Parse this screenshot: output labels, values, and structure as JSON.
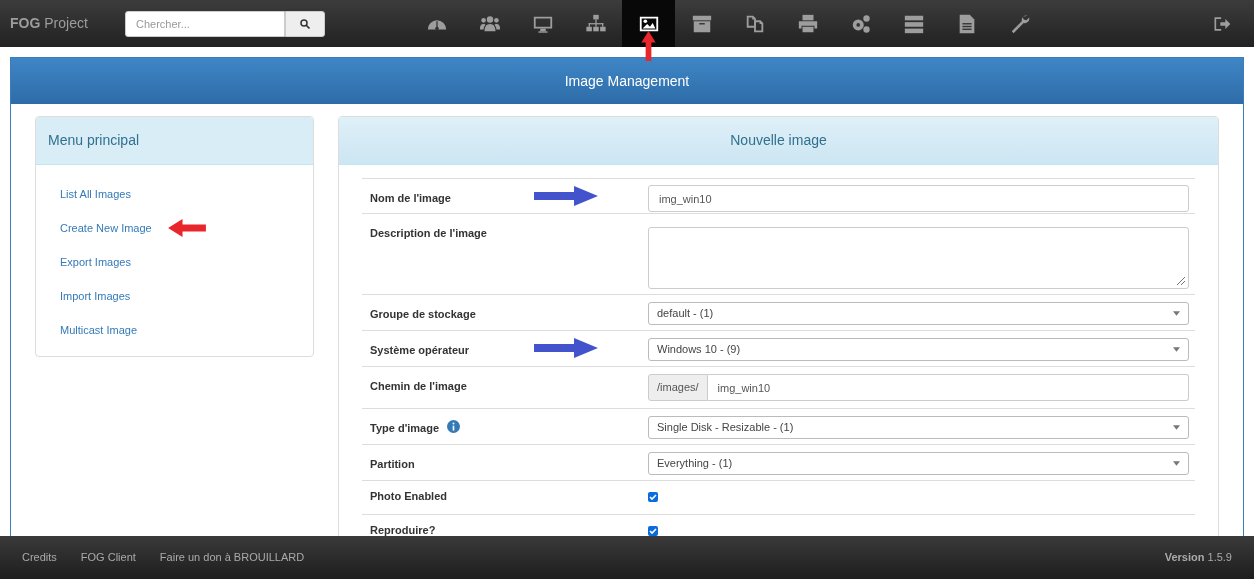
{
  "navbar": {
    "brand_bold": "FOG",
    "brand_rest": "Project",
    "search": {
      "placeholder": "Chercher..."
    },
    "icons": [
      {
        "kind": "dashboard",
        "selected": false
      },
      {
        "kind": "users",
        "selected": false
      },
      {
        "kind": "monitor",
        "selected": false
      },
      {
        "kind": "network",
        "selected": false
      },
      {
        "kind": "image",
        "selected": true,
        "arrow": {
          "color": "#e8262b"
        }
      },
      {
        "kind": "archive",
        "selected": false
      },
      {
        "kind": "copy",
        "selected": false
      },
      {
        "kind": "printer",
        "selected": false
      },
      {
        "kind": "gears",
        "selected": false
      },
      {
        "kind": "server",
        "selected": false
      },
      {
        "kind": "file",
        "selected": false
      },
      {
        "kind": "wrench",
        "selected": false
      }
    ],
    "logout": {
      "kind": "logout"
    }
  },
  "panel": {
    "title": "Image Management"
  },
  "menu": {
    "title": "Menu principal",
    "items": [
      {
        "label": "List All Images"
      },
      {
        "label": "Create New Image",
        "arrow": {
          "color": "#e8262b"
        }
      },
      {
        "label": "Export Images"
      },
      {
        "label": "Import Images"
      },
      {
        "label": "Multicast Image"
      }
    ]
  },
  "form": {
    "title": "Nouvelle image",
    "rows": [
      {
        "kind": "text",
        "label": "Nom de l'image",
        "value": "img_win10",
        "arrow": {
          "color": "#4353cc"
        }
      },
      {
        "kind": "textarea",
        "label": "Description de l'image"
      },
      {
        "kind": "select",
        "label": "Groupe de stockage",
        "value": "default - (1)"
      },
      {
        "kind": "select",
        "label": "Système opérateur",
        "value": "Windows 10 - (9)",
        "arrow": {
          "color": "#4353cc"
        }
      },
      {
        "kind": "prefixed",
        "label": "Chemin de l'image",
        "prefix": "/images/",
        "value": "img_win10"
      },
      {
        "kind": "select",
        "label": "Type d'image",
        "info": true,
        "value": "Single Disk - Resizable - (1)"
      },
      {
        "kind": "select",
        "label": "Partition",
        "value": "Everything - (1)"
      },
      {
        "kind": "checkbox",
        "label": "Photo Enabled",
        "checked": true
      },
      {
        "kind": "checkbox",
        "label": "Reproduire?",
        "checked": true
      }
    ]
  },
  "footer": {
    "links": [
      "Credits",
      "FOG Client",
      "Faire un don à BROUILLARD"
    ],
    "version": "**Version** 1.5.9"
  }
}
